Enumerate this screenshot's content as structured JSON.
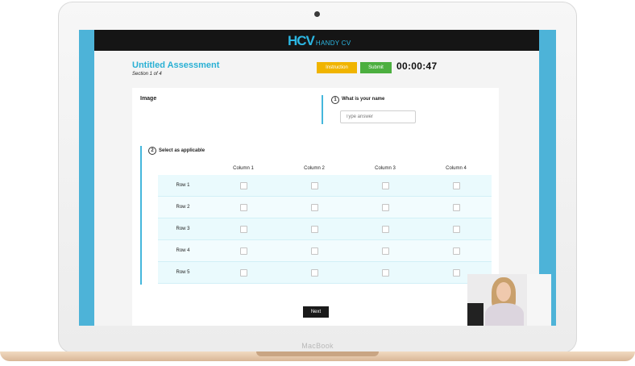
{
  "device": {
    "label": "MacBook"
  },
  "header": {
    "logo_mark": "HCV",
    "logo_text": "HANDY CV"
  },
  "assessment": {
    "title": "Untitled Assessment",
    "section": "Section 1 of 4"
  },
  "toolbar": {
    "instruction_label": "Instruction",
    "submit_label": "Submit",
    "timer": "00:00:47"
  },
  "content": {
    "image_label": "Image",
    "q1": {
      "number": "1",
      "title": "What is your name",
      "placeholder": "Type answer"
    },
    "q2": {
      "number": "2",
      "title": "Select as applicable",
      "columns": [
        "Column 1",
        "Column 2",
        "Column 3",
        "Column 4"
      ],
      "rows": [
        "Row 1",
        "Row 2",
        "Row 3",
        "Row 4",
        "Row 5"
      ]
    }
  },
  "footer": {
    "next_label": "Next"
  },
  "colors": {
    "accent": "#29b0d4",
    "instruction": "#f0b400",
    "submit": "#4caf3f",
    "topbar": "#151515",
    "frame_blue": "#4db3d8"
  }
}
